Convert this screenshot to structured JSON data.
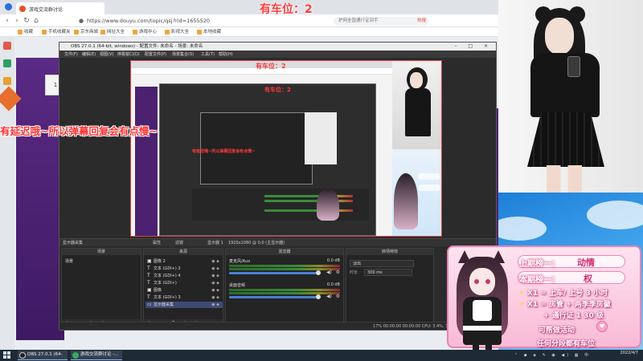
{
  "overlay": {
    "title": "有车位：2",
    "delay_notice": "有延迟哦~所以弹幕回复会有点慢~"
  },
  "browser": {
    "tab_label": "游戏交流群讨论",
    "url": "https://www.douyu.com/topic/qsj?rid=1655520",
    "search_placeholder": "护网全国通行证到手",
    "search_button": "热搜",
    "bookmarks": [
      "收藏",
      "手机收藏夹",
      "京东商城",
      "网址大全",
      "游戏中心",
      "影视大全",
      "本地收藏"
    ],
    "page_number": "1"
  },
  "obs": {
    "title": "OBS 27.0.1 (64-bit, windows) - 配置文件: 未命名 - 场景: 未命名",
    "menu": [
      "文件(F)",
      "编辑(E)",
      "视图(V)",
      "停靠窗口(D)",
      "配置文件(P)",
      "场景集合(S)",
      "工具(T)",
      "帮助(H)"
    ],
    "scene_toolbar": [
      "显示器采集",
      "属性",
      "滤镜",
      "显示器 1",
      "1920x1080 @ 0,0 (主显示器)"
    ],
    "docks": {
      "scenes": "场景",
      "sources": "来源",
      "mixer": "混音器",
      "transitions": "转场特效"
    },
    "scenes": [
      "场景"
    ],
    "sources": [
      {
        "label": "图像 2",
        "type": "image"
      },
      {
        "label": "文本 (GDI+) 2",
        "type": "text"
      },
      {
        "label": "文本 (GDI+) 4",
        "type": "text"
      },
      {
        "label": "文本 (GDI+)",
        "type": "text"
      },
      {
        "label": "图像",
        "type": "image"
      },
      {
        "label": "文本 (GDI+) 3",
        "type": "text"
      },
      {
        "label": "显示器采集",
        "type": "display"
      }
    ],
    "mixer": [
      {
        "name": "麦克风/Aux",
        "db": "0.0 dB"
      },
      {
        "name": "桌面音频",
        "db": "0.0 dB"
      }
    ],
    "transitions": {
      "type": "淡出",
      "duration_label": "时长",
      "duration": "300 ms"
    },
    "status": "17% 00:00:00  00:00:00  CPU: 3.4%, 30.00 fps"
  },
  "preview_overlay": {
    "title": "有车位：2",
    "delay_notice": "有延迟哦~所以弹幕回复会有点慢~"
  },
  "infocard": {
    "line1_label": "上期榜一：",
    "line1_value": "动情",
    "line2_label": "本期榜一：",
    "line2_value": "权",
    "perks": [
      "X1 = 上车/ 上号 3 小时",
      "X1 = 房管 + 两季季房徽",
      "+ 通行证 1 30 级",
      "可帮做活动",
      "任何分段都有车位"
    ]
  },
  "taskbar": {
    "items": [
      "OBS 27.0.1 (64-bit...",
      "游戏交流群讨论 -..."
    ],
    "time": "",
    "date": "2022/4/7"
  },
  "colors": {
    "overlay_red": "#ff3030",
    "card_pink": "#f9bad6",
    "obs_dark": "#2b2b2b",
    "brand_orange": "#e7502f"
  },
  "icons": [
    "back-icon",
    "forward-icon",
    "refresh-icon",
    "home-icon",
    "eye-icon",
    "lock-icon",
    "gear-icon",
    "speaker-icon",
    "text-icon",
    "image-icon",
    "monitor-icon",
    "windows-start-icon",
    "heart-icon"
  ]
}
